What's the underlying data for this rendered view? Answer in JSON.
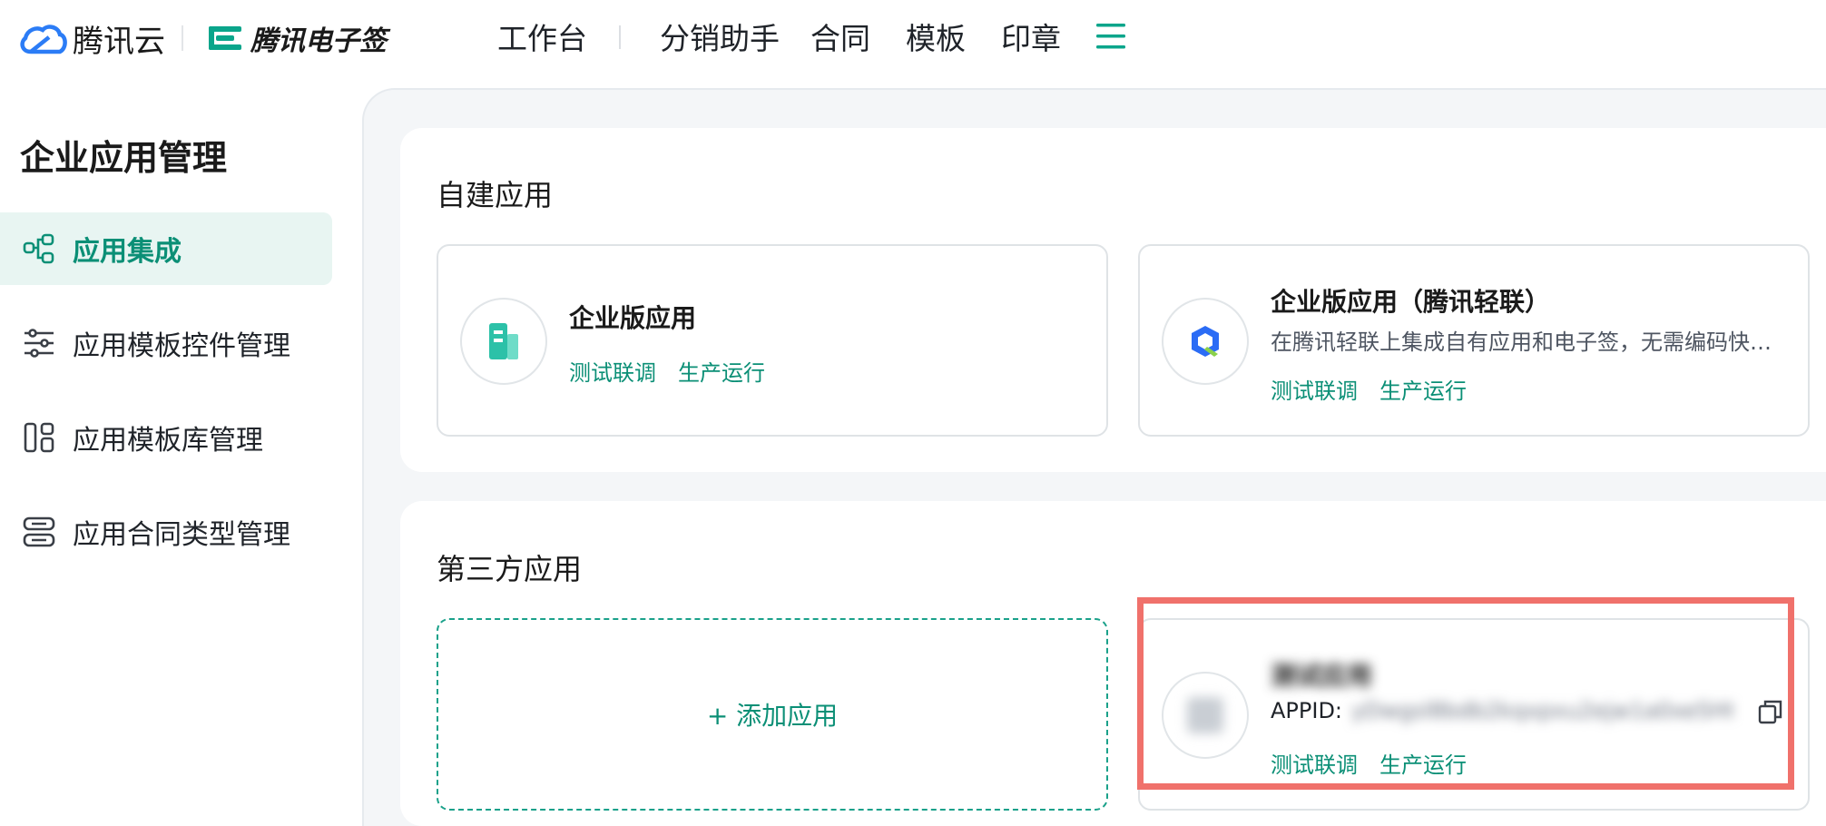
{
  "brand": {
    "name": "腾讯云"
  },
  "product": {
    "name": "腾讯电子签"
  },
  "nav": {
    "items": [
      "工作台",
      "分销助手",
      "合同",
      "模板",
      "印章"
    ]
  },
  "sidebar": {
    "title": "企业应用管理",
    "items": [
      {
        "label": "应用集成",
        "icon": "integration-icon",
        "active": true
      },
      {
        "label": "应用模板控件管理",
        "icon": "sliders-icon"
      },
      {
        "label": "应用模板库管理",
        "icon": "library-icon"
      },
      {
        "label": "应用合同类型管理",
        "icon": "contract-type-icon"
      }
    ]
  },
  "self_built": {
    "title": "自建应用",
    "cards": [
      {
        "name": "企业版应用",
        "links": [
          "测试联调",
          "生产运行"
        ],
        "icon": "building-icon"
      },
      {
        "name": "企业版应用（腾讯轻联）",
        "desc": "在腾讯轻联上集成自有应用和电子签，无需编码快速实现",
        "links": [
          "测试联调",
          "生产运行"
        ],
        "icon": "qinglian-logo-icon"
      }
    ]
  },
  "third_party": {
    "title": "第三方应用",
    "add_label": "+ 添加应用",
    "card": {
      "name": "测试应用",
      "appid_label": "APPID:",
      "appid_value": "yDwgsl8bdb2kqxpxu2ejw1a0xe5HtHc3dnjf",
      "links": [
        "测试联调",
        "生产运行"
      ],
      "icon": "app-avatar-icon"
    }
  },
  "colors": {
    "accent": "#0b8f76",
    "highlight": "#f0716b"
  }
}
